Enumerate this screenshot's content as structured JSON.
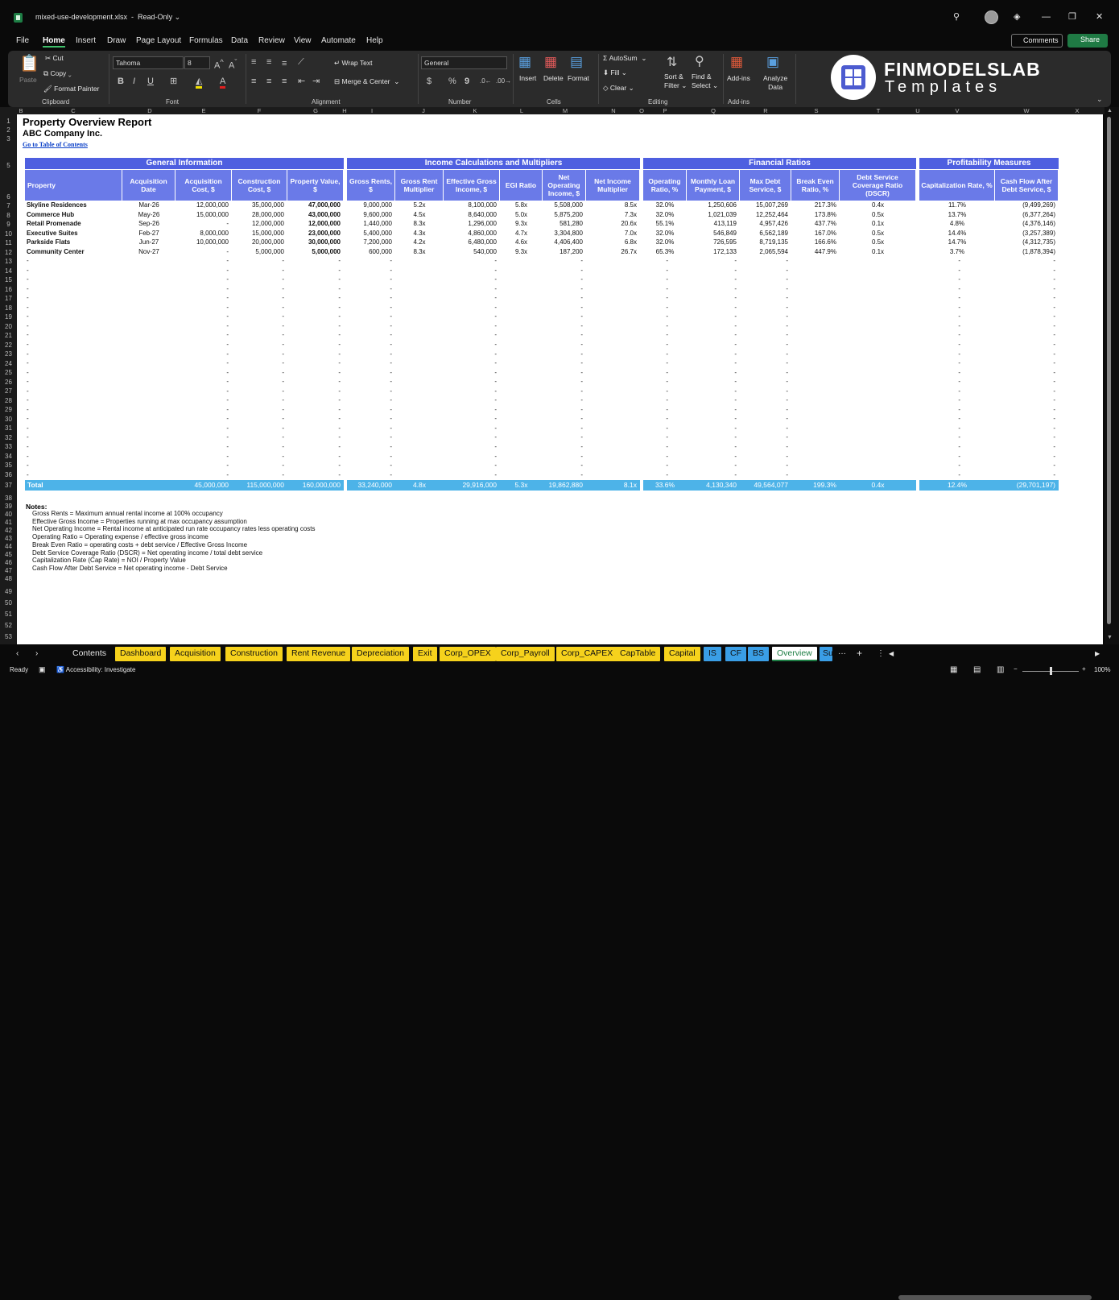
{
  "window": {
    "filename": "mixed-use-development.xlsx",
    "status": "Read-Only",
    "minimize_icon": "—",
    "maximize_icon": "❐",
    "close_icon": "✕"
  },
  "menu": {
    "items": [
      "File",
      "Home",
      "Insert",
      "Draw",
      "Page Layout",
      "Formulas",
      "Data",
      "Review",
      "View",
      "Automate",
      "Help"
    ],
    "comments": "Comments",
    "share": "Share"
  },
  "ribbon": {
    "clipboard": {
      "paste": "Paste",
      "cut": "Cut",
      "copy": "Copy",
      "format_painter": "Format Painter",
      "group": "Clipboard"
    },
    "font": {
      "name": "Tahoma",
      "size": "8",
      "group": "Font",
      "bold": "B",
      "italic": "I",
      "underline": "U"
    },
    "alignment": {
      "wrap": "Wrap Text",
      "merge": "Merge & Center",
      "group": "Alignment"
    },
    "number": {
      "format": "General",
      "group": "Number",
      "currency": "$",
      "percent": "%",
      "comma": "9"
    },
    "cells": {
      "insert": "Insert",
      "delete": "Delete",
      "format": "Format",
      "group": "Cells"
    },
    "editing": {
      "autosum": "AutoSum",
      "fill": "Fill",
      "clear": "Clear",
      "sort": "Sort &",
      "sort2": "Filter",
      "find": "Find &",
      "find2": "Select",
      "group": "Editing"
    },
    "addins": {
      "addins": "Add-ins",
      "analyze": "Analyze",
      "analyze2": "Data",
      "group": "Add-ins"
    },
    "logo": {
      "line1": "FINMODELSLAB",
      "line2": "Templates"
    }
  },
  "columns": [
    "B",
    "C",
    "D",
    "E",
    "F",
    "G",
    "H",
    "I",
    "J",
    "K",
    "L",
    "M",
    "N",
    "O",
    "P",
    "Q",
    "R",
    "S",
    "T",
    "U",
    "V",
    "W",
    "X"
  ],
  "rows": [
    "1",
    "2",
    "3",
    "5",
    "6",
    "7",
    "8",
    "9",
    "10",
    "11",
    "12",
    "13",
    "14",
    "15",
    "16",
    "17",
    "18",
    "19",
    "20",
    "21",
    "22",
    "23",
    "24",
    "25",
    "26",
    "27",
    "28",
    "29",
    "30",
    "31",
    "32",
    "33",
    "34",
    "35",
    "36",
    "37",
    "38",
    "39",
    "40",
    "41",
    "42",
    "43",
    "44",
    "45",
    "46",
    "47",
    "48",
    "49",
    "50",
    "51",
    "52",
    "53"
  ],
  "report": {
    "title": "Property Overview Report",
    "company": "ABC Company Inc.",
    "link": "Go to Table of Contents"
  },
  "sections": [
    "General Information",
    "Income Calculations and Multipliers",
    "Financial Ratios",
    "Profitability Measures"
  ],
  "headers": [
    "Property",
    "Acquisition Date",
    "Acquisition Cost, $",
    "Construction Cost, $",
    "Property Value, $",
    "Gross Rents, $",
    "Gross Rent Multiplier",
    "Effective Gross Income, $",
    "EGI Ratio",
    "Net Operating Income, $",
    "Net Income Multiplier",
    "Operating Ratio, %",
    "Monthly Loan Payment, $",
    "Max Debt Service, $",
    "Break Even Ratio, %",
    "Debt Service Coverage Ratio (DSCR)",
    "Capitalization Rate, %",
    "Cash Flow After Debt Service, $"
  ],
  "data_rows": [
    [
      "Skyline Residences",
      "Mar-26",
      "12,000,000",
      "35,000,000",
      "47,000,000",
      "9,000,000",
      "5.2x",
      "8,100,000",
      "5.8x",
      "5,508,000",
      "8.5x",
      "32.0%",
      "1,250,606",
      "15,007,269",
      "217.3%",
      "0.4x",
      "11.7%",
      "(9,499,269)"
    ],
    [
      "Commerce Hub",
      "May-26",
      "15,000,000",
      "28,000,000",
      "43,000,000",
      "9,600,000",
      "4.5x",
      "8,640,000",
      "5.0x",
      "5,875,200",
      "7.3x",
      "32.0%",
      "1,021,039",
      "12,252,464",
      "173.8%",
      "0.5x",
      "13.7%",
      "(6,377,264)"
    ],
    [
      "Retail Promenade",
      "Sep-26",
      "-",
      "12,000,000",
      "12,000,000",
      "1,440,000",
      "8.3x",
      "1,296,000",
      "9.3x",
      "581,280",
      "20.6x",
      "55.1%",
      "413,119",
      "4,957,426",
      "437.7%",
      "0.1x",
      "4.8%",
      "(4,376,146)"
    ],
    [
      "Executive Suites",
      "Feb-27",
      "8,000,000",
      "15,000,000",
      "23,000,000",
      "5,400,000",
      "4.3x",
      "4,860,000",
      "4.7x",
      "3,304,800",
      "7.0x",
      "32.0%",
      "546,849",
      "6,562,189",
      "167.0%",
      "0.5x",
      "14.4%",
      "(3,257,389)"
    ],
    [
      "Parkside Flats",
      "Jun-27",
      "10,000,000",
      "20,000,000",
      "30,000,000",
      "7,200,000",
      "4.2x",
      "6,480,000",
      "4.6x",
      "4,406,400",
      "6.8x",
      "32.0%",
      "726,595",
      "8,719,135",
      "166.6%",
      "0.5x",
      "14.7%",
      "(4,312,735)"
    ],
    [
      "Community Center",
      "Nov-27",
      "-",
      "5,000,000",
      "5,000,000",
      "600,000",
      "8.3x",
      "540,000",
      "9.3x",
      "187,200",
      "26.7x",
      "65.3%",
      "172,133",
      "2,065,594",
      "447.9%",
      "0.1x",
      "3.7%",
      "(1,878,394)"
    ]
  ],
  "empty_dash": "-",
  "totals": [
    "Total",
    "45,000,000",
    "115,000,000",
    "160,000,000",
    "33,240,000",
    "4.8x",
    "29,916,000",
    "5.3x",
    "19,862,880",
    "8.1x",
    "33.6%",
    "4,130,340",
    "49,564,077",
    "199.3%",
    "0.4x",
    "12.4%",
    "(29,701,197)"
  ],
  "notes": {
    "heading": "Notes:",
    "lines": [
      "Gross Rents = Maximum annual rental income at 100% occupancy",
      "Effective Gross Income = Properties running at max occupancy assumption",
      "Net Operating Income = Rental income at anticipated run rate occupancy rates less operating costs",
      "Operating Ratio = Operating expense / effective gross income",
      "Break Even Ratio = operating costs + debt service / Effective Gross Income",
      "Debt Service Coverage Ratio (DSCR) = Net operating income / total debt service",
      "Capitalization Rate (Cap Rate) = NOI / Property Value",
      "Cash Flow After Debt Service = Net operating income - Debt Service"
    ]
  },
  "tabs": [
    {
      "label": "Contents",
      "style": "plain"
    },
    {
      "label": "Dashboard",
      "style": "yellow"
    },
    {
      "label": "Acquisition",
      "style": "yellow"
    },
    {
      "label": "Construction",
      "style": "yellow"
    },
    {
      "label": "Rent Revenue",
      "style": "yellow"
    },
    {
      "label": "Depreciation",
      "style": "yellow"
    },
    {
      "label": "Exit",
      "style": "yellow"
    },
    {
      "label": "Corp_OPEX",
      "style": "yellow"
    },
    {
      "label": "Corp_Payroll",
      "style": "yellow"
    },
    {
      "label": "Corp_CAPEX",
      "style": "yellow"
    },
    {
      "label": "CapTable",
      "style": "yellow"
    },
    {
      "label": "Capital",
      "style": "yellow"
    },
    {
      "label": "IS",
      "style": "blue"
    },
    {
      "label": "CF",
      "style": "blue"
    },
    {
      "label": "BS",
      "style": "blue"
    },
    {
      "label": "Overview",
      "style": "active"
    },
    {
      "label": "Su",
      "style": "blue"
    }
  ],
  "status": {
    "ready": "Ready",
    "accessibility": "Accessibility: Investigate",
    "zoom": "100%"
  }
}
